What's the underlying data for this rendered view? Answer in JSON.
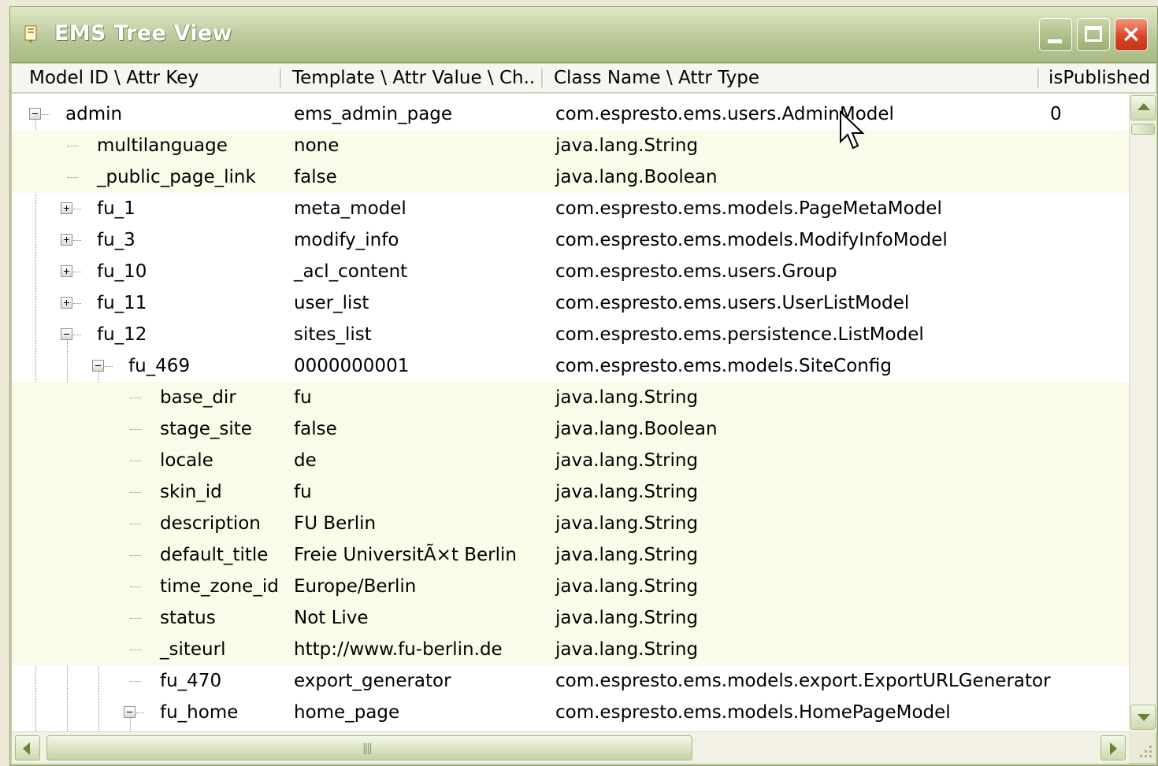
{
  "window": {
    "title": "EMS Tree View",
    "buttons": {
      "minimize": "minimize",
      "maximize": "maximize",
      "close": "×"
    }
  },
  "columns": [
    "Model ID \\ Attr Key",
    "Template \\ Attr Value \\ Ch...",
    "Class Name \\ Attr Type",
    "isPublished"
  ],
  "rows": [
    {
      "key": "admin",
      "value": "ems_admin_page",
      "type": "com.espresto.ems.users.AdminModel",
      "published": "0"
    },
    {
      "key": "multilanguage",
      "value": "none",
      "type": "java.lang.String",
      "published": ""
    },
    {
      "key": "_public_page_link",
      "value": "false",
      "type": "java.lang.Boolean",
      "published": ""
    },
    {
      "key": "fu_1",
      "value": "meta_model",
      "type": "com.espresto.ems.models.PageMetaModel",
      "published": ""
    },
    {
      "key": "fu_3",
      "value": "modify_info",
      "type": "com.espresto.ems.models.ModifyInfoModel",
      "published": ""
    },
    {
      "key": "fu_10",
      "value": "_acl_content",
      "type": "com.espresto.ems.users.Group",
      "published": ""
    },
    {
      "key": "fu_11",
      "value": "user_list",
      "type": "com.espresto.ems.users.UserListModel",
      "published": ""
    },
    {
      "key": "fu_12",
      "value": "sites_list",
      "type": "com.espresto.ems.persistence.ListModel",
      "published": ""
    },
    {
      "key": "fu_469",
      "value": "0000000001",
      "type": "com.espresto.ems.models.SiteConfig",
      "published": ""
    },
    {
      "key": "base_dir",
      "value": "fu",
      "type": "java.lang.String",
      "published": ""
    },
    {
      "key": "stage_site",
      "value": "false",
      "type": "java.lang.Boolean",
      "published": ""
    },
    {
      "key": "locale",
      "value": "de",
      "type": "java.lang.String",
      "published": ""
    },
    {
      "key": "skin_id",
      "value": "fu",
      "type": "java.lang.String",
      "published": ""
    },
    {
      "key": "description",
      "value": "FU Berlin",
      "type": "java.lang.String",
      "published": ""
    },
    {
      "key": "default_title",
      "value": "Freie UniversitÃ×t Berlin",
      "type": "java.lang.String",
      "published": ""
    },
    {
      "key": "time_zone_id",
      "value": "Europe/Berlin",
      "type": "java.lang.String",
      "published": ""
    },
    {
      "key": "status",
      "value": "Not Live",
      "type": "java.lang.String",
      "published": ""
    },
    {
      "key": "_siteurl",
      "value": "http://www.fu-berlin.de",
      "type": "java.lang.String",
      "published": ""
    },
    {
      "key": "fu_470",
      "value": "export_generator",
      "type": "com.espresto.ems.models.export.ExportURLGenerator",
      "published": ""
    },
    {
      "key": "fu_home",
      "value": "home_page",
      "type": "com.espresto.ems.models.HomePageModel",
      "published": ""
    }
  ]
}
